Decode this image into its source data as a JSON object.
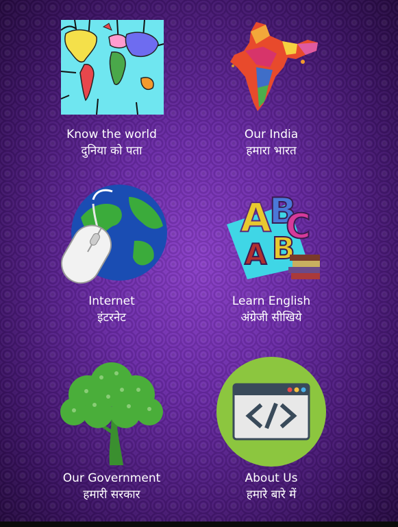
{
  "tiles": [
    {
      "id": "know-the-world",
      "label_en": "Know the world",
      "label_hi": "दुनिया को पता",
      "icon": "world-map-icon"
    },
    {
      "id": "our-india",
      "label_en": "Our India",
      "label_hi": "हमारा भारत",
      "icon": "india-map-icon"
    },
    {
      "id": "internet",
      "label_en": "Internet",
      "label_hi": "इंटरनेट",
      "icon": "globe-mouse-icon"
    },
    {
      "id": "learn-english",
      "label_en": "Learn English",
      "label_hi": "अंग्रेजी सीखिये",
      "icon": "abc-books-icon"
    },
    {
      "id": "our-government",
      "label_en": "Our Government",
      "label_hi": "हमारी सरकार",
      "icon": "tree-icon"
    },
    {
      "id": "about-us",
      "label_en": "About Us",
      "label_hi": "हमारे बारे में",
      "icon": "code-window-icon"
    }
  ],
  "colors": {
    "background_center": "#8a3fc8",
    "background_edge": "#250a3f",
    "text": "#ffffff",
    "about_circle": "#8cc63f",
    "tree_green": "#3f9a36"
  }
}
